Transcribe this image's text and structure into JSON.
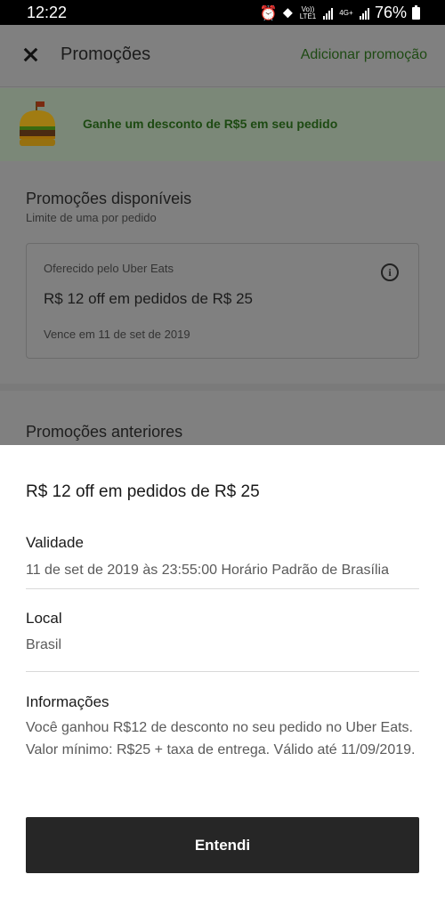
{
  "status_bar": {
    "time": "12:22",
    "volte_label": "Vo)) LTE1",
    "network_label": "4G+",
    "battery_percent": "76%"
  },
  "header": {
    "close_icon": "close-icon",
    "title": "Promoções",
    "action_label": "Adicionar promoção",
    "action_color": "#1e4a13"
  },
  "banner": {
    "icon": "burger-icon",
    "text": "Ganhe um desconto de R$5 em seu pedido"
  },
  "available": {
    "title": "Promoções disponíveis",
    "subtitle": "Limite de uma por pedido",
    "card": {
      "offered_by": "Oferecido pelo Uber Eats",
      "title": "R$ 12 off em pedidos de R$ 25",
      "expiry": "Vence em 11 de set de 2019",
      "info_icon": "info-icon"
    }
  },
  "past": {
    "title": "Promoções anteriores"
  },
  "sheet": {
    "title": "R$ 12 off em pedidos de R$ 25",
    "validity_label": "Validade",
    "validity_value": "11 de set de 2019 às 23:55:00 Horário Padrão de Brasília",
    "location_label": "Local",
    "location_value": "Brasil",
    "info_label": "Informações",
    "info_value": "Você ganhou R$12 de desconto no seu pedido no Uber Eats. Valor mínimo: R$25 + taxa de entrega. Válido até 11/09/2019.",
    "button_label": "Entendi"
  }
}
